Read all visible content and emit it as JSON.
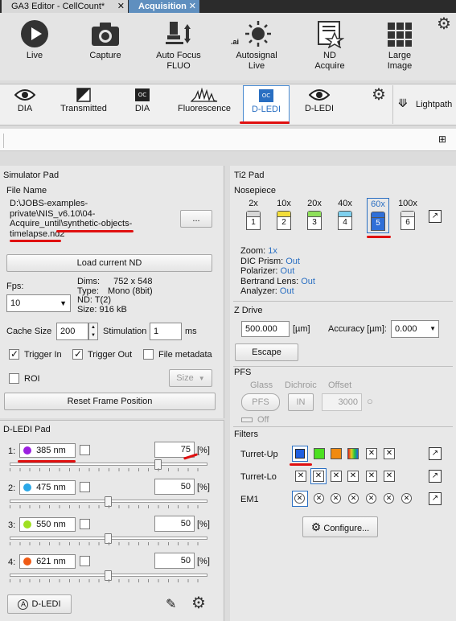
{
  "tabs": [
    {
      "label": "GA3 Editor - CellCount*",
      "close": "✕"
    },
    {
      "label": "Acquisition",
      "close": "✕"
    }
  ],
  "toolbar": {
    "live": "Live",
    "capture": "Capture",
    "autofocus_1": "Auto Focus",
    "autofocus_2": "FLUO",
    "autosignal_1": "Autosignal",
    "autosignal_2": "Live",
    "nd_1": "ND",
    "nd_2": "Acquire",
    "large_1": "Large",
    "large_2": "Image",
    "ai_badge": ".ai"
  },
  "optical_configs": [
    {
      "label": "DIA",
      "icon": "eye-icon"
    },
    {
      "label": "Transmitted",
      "icon": "half-square-icon"
    },
    {
      "label": "DIA",
      "icon": "oc-icon",
      "badge": "OC"
    },
    {
      "label": "Fluorescence",
      "icon": "spectrum-icon"
    },
    {
      "label": "D-LEDI",
      "icon": "oc-icon",
      "badge": "OC",
      "selected": true
    },
    {
      "label": "D-LEDI",
      "icon": "eye-icon"
    }
  ],
  "lightpath": "Lightpath",
  "simulator": {
    "title": "Simulator Pad",
    "file_name_label": "File Name",
    "file_lines": [
      "D:\\JOBS-examples-",
      "private\\NIS_v6.10\\04-",
      "Acquire_until\\synthetic-objects-",
      "timelapse.nd2"
    ],
    "browse": "...",
    "load": "Load current ND",
    "fps_label": "Fps:",
    "fps_value": "10",
    "dims_label": "Dims:",
    "dims_value": "752 x 548",
    "type_label": "Type:",
    "type_value": "Mono (8bit)",
    "nd_label": "ND:",
    "nd_value": "T(2)",
    "size_label": "Size:",
    "size_value": "916 kB",
    "cache_label": "Cache Size",
    "cache_value": "200",
    "stim_label": "Stimulation",
    "stim_value": "1",
    "stim_unit": "ms",
    "trigger_in": "Trigger In",
    "trigger_out": "Trigger Out",
    "file_metadata": "File metadata",
    "roi": "ROI",
    "size_btn": "Size",
    "reset": "Reset Frame Position"
  },
  "dledi": {
    "title": "D-LEDI Pad",
    "channels": [
      {
        "index": "1:",
        "wavelength": "385 nm",
        "color": "#9b1fe0",
        "value": "75",
        "unit": "[%]",
        "level": 0.75
      },
      {
        "index": "2:",
        "wavelength": "475 nm",
        "color": "#2aa8e8",
        "value": "50",
        "unit": "[%]",
        "level": 0.5
      },
      {
        "index": "3:",
        "wavelength": "550 nm",
        "color": "#9fe020",
        "value": "50",
        "unit": "[%]",
        "level": 0.5
      },
      {
        "index": "4:",
        "wavelength": "621 nm",
        "color": "#f05a14",
        "value": "50",
        "unit": "[%]",
        "level": 0.5
      }
    ],
    "button": "D-LEDI",
    "button_icon": "A"
  },
  "ti2": {
    "title": "Ti2 Pad",
    "nosepiece_label": "Nosepiece",
    "objectives": [
      {
        "mag": "2x",
        "pos": "1",
        "color": "#d8d8d8"
      },
      {
        "mag": "10x",
        "pos": "2",
        "color": "#f2dd3a"
      },
      {
        "mag": "20x",
        "pos": "3",
        "color": "#8ee05a"
      },
      {
        "mag": "40x",
        "pos": "4",
        "color": "#7fd0ee"
      },
      {
        "mag": "60x",
        "pos": "5",
        "color": "#2f6fd8",
        "selected": true
      },
      {
        "mag": "100x",
        "pos": "6",
        "color": "#e8e8e8"
      }
    ],
    "zoom_label": "Zoom:",
    "zoom_value": "1x",
    "dic_label": "DIC Prism:",
    "dic_value": "Out",
    "pol_label": "Polarizer:",
    "pol_value": "Out",
    "bert_label": "Bertrand Lens:",
    "bert_value": "Out",
    "ana_label": "Analyzer:",
    "ana_value": "Out",
    "zdrive_label": "Z Drive",
    "z_value": "500.000",
    "z_unit": "[µm]",
    "accuracy_label": "Accuracy [µm]:",
    "accuracy_value": "0.000",
    "escape": "Escape",
    "pfs_label": "PFS",
    "glass": "Glass",
    "dichroic": "Dichroic",
    "offset": "Offset",
    "pfs_btn": "PFS",
    "in_btn": "IN",
    "offset_value": "3000",
    "off": "Off",
    "filters_label": "Filters",
    "turret_up": "Turret-Up",
    "turret_lo": "Turret-Lo",
    "em1": "EM1",
    "configure": "Configure..."
  }
}
